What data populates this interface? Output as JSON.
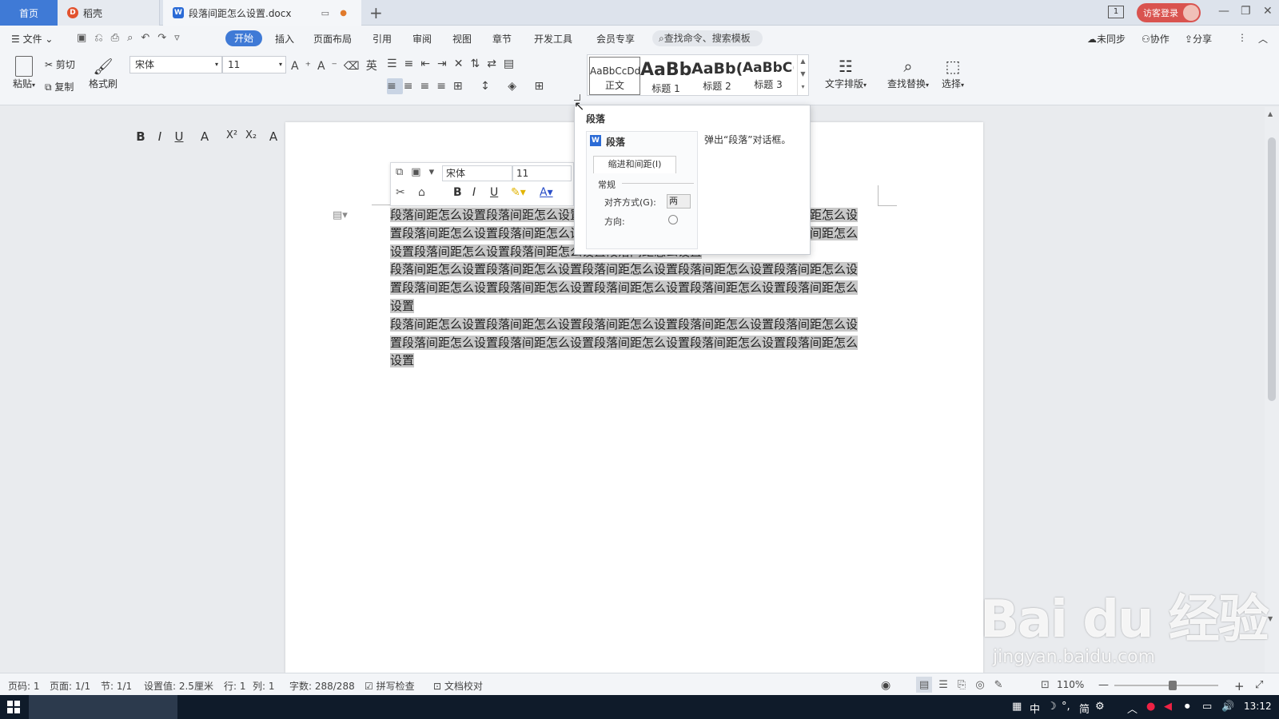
{
  "titlebar": {
    "tabs": [
      {
        "label": "首页"
      },
      {
        "label": "稻壳"
      },
      {
        "label": "段落间距怎么设置.docx"
      }
    ],
    "new_tab": "+",
    "visitor_label": "访客登录",
    "page_indicator": "1"
  },
  "menubar": {
    "file": "文件",
    "items": [
      "开始",
      "插入",
      "页面布局",
      "引用",
      "审阅",
      "视图",
      "章节",
      "开发工具",
      "会员专享"
    ],
    "search_placeholder": "查找命令、搜索模板",
    "sync": "未同步",
    "collab": "协作",
    "share": "分享"
  },
  "ribbon": {
    "paste": "粘贴",
    "cut": "剪切",
    "copy": "复制",
    "format_painter": "格式刷",
    "font_name": "宋体",
    "font_size": "11",
    "styles": [
      {
        "preview": "AaBbCcDd",
        "label": "正文"
      },
      {
        "preview": "AaBb",
        "label": "标题 1"
      },
      {
        "preview": "AaBb(",
        "label": "标题 2"
      },
      {
        "preview": "AaBbC(",
        "label": "标题 3"
      }
    ],
    "text_layout": "文字排版",
    "find_replace": "查找替换",
    "select": "选择"
  },
  "mini_toolbar": {
    "font_name": "宋体",
    "font_size": "11"
  },
  "tooltip": {
    "title": "段落",
    "description": "弹出“段落”对话框。",
    "preview": {
      "dialog_title": "段落",
      "tab": "缩进和间距(I)",
      "section": "常规",
      "align_label": "对齐方式(G):",
      "align_value": "两",
      "direction_label": "方向:"
    }
  },
  "document": {
    "paragraphs": [
      "段落间距怎么设置段落间距怎么设置段落间距怎么设置段落间距怎么设置段落间距怎么设置段落间距怎么设置段落间距怎么设置段落间距怎么设置段落间距怎么设置段落间距怎么设置段落间距怎么设置段落间距怎么设置段落间距怎么设置",
      "段落间距怎么设置段落间距怎么设置段落间距怎么设置段落间距怎么设置段落间距怎么设置段落间距怎么设置段落间距怎么设置段落间距怎么设置段落间距怎么设置段落间距怎么设置",
      "段落间距怎么设置段落间距怎么设置段落间距怎么设置段落间距怎么设置段落间距怎么设置段落间距怎么设置段落间距怎么设置段落间距怎么设置段落间距怎么设置段落间距怎么设置"
    ]
  },
  "statusbar": {
    "page_code": "页码: 1",
    "pages": "页面: 1/1",
    "section": "节: 1/1",
    "setting": "设置值: 2.5厘米",
    "row": "行: 1",
    "col": "列: 1",
    "words": "字数: 288/288",
    "spell_check": "拼写检查",
    "doc_proof": "文档校对",
    "zoom": "110%"
  },
  "taskbar": {
    "ime": "中",
    "ime_mode": "简",
    "clock": "13:12"
  },
  "watermark": {
    "main": "Bai du 经验",
    "url": "jingyan.baidu.com"
  },
  "colors": {
    "accent": "#3f7ad6",
    "visitor": "#d9534f",
    "selection": "#c8c8c8"
  }
}
